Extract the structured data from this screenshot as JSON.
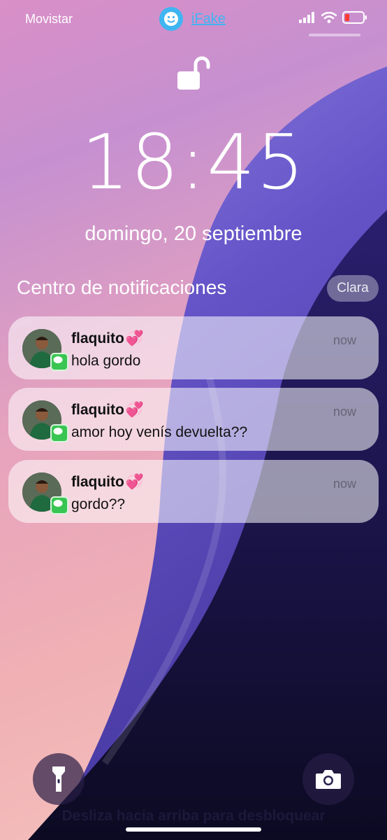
{
  "status_bar": {
    "carrier": "Movistar",
    "app_label": "iFake",
    "icons": [
      "signal-icon",
      "wifi-icon",
      "battery-icon"
    ]
  },
  "lock_screen": {
    "time": "18:45",
    "date": "domingo, 20 septiembre",
    "notification_center_title": "Centro de notificaciones",
    "clear_label": "Clara",
    "swipe_hint": "Desliza hacia arriba para desbloquear",
    "buttons": [
      "flashlight-icon",
      "camera-icon"
    ]
  },
  "notifications": [
    {
      "sender": "flaquito",
      "emoji": "💞",
      "time": "now",
      "body": "hola gordo"
    },
    {
      "sender": "flaquito",
      "emoji": "💞",
      "time": "now",
      "body": "amor hoy venís devuelta??"
    },
    {
      "sender": "flaquito",
      "emoji": "💞",
      "time": "now",
      "body": "gordo??"
    }
  ],
  "colors": {
    "accent_app_label": "#3fb5f2",
    "message_badge": "#39c552",
    "heart": "#e2459b"
  }
}
